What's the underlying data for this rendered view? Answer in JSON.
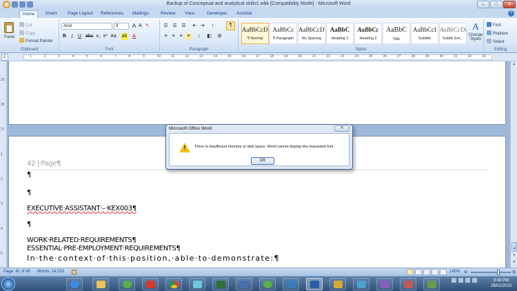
{
  "window": {
    "title": "Backup of Conceptual and analytical skills1.wbk [Compatibility Mode] - Microsoft Word",
    "minimize": "–",
    "maximize": "□",
    "close": "✕"
  },
  "tabs": [
    "Home",
    "Insert",
    "Page Layout",
    "References",
    "Mailings",
    "Review",
    "View",
    "Developer",
    "Acrobat"
  ],
  "ribbon": {
    "clipboard": {
      "label": "Clipboard",
      "paste": "Paste",
      "cut": "Cut",
      "copy": "Copy",
      "format_painter": "Format Painter"
    },
    "font": {
      "label": "Font",
      "name": "Arial",
      "size": "9"
    },
    "paragraph": {
      "label": "Paragraph"
    },
    "styles": {
      "label": "Styles",
      "items": [
        {
          "sample": "AaBbCcDc",
          "name": "¶ Normal"
        },
        {
          "sample": "AaBbCc",
          "name": "¶ Paragraph"
        },
        {
          "sample": "AaBbCcDc",
          "name": "No Spacing"
        },
        {
          "sample": "AaBbC",
          "name": "Heading 1"
        },
        {
          "sample": "AaBbCc",
          "name": "Heading 2"
        },
        {
          "sample": "AaBbC",
          "name": "Title"
        },
        {
          "sample": "AaBbCcI",
          "name": "Subtitle"
        },
        {
          "sample": "AaBbCcDt",
          "name": "Subtle Em..."
        }
      ],
      "change_styles": "Change Styles"
    },
    "editing": {
      "label": "Editing",
      "find": "Find",
      "replace": "Replace",
      "select": "Select"
    }
  },
  "ruler": {
    "marks": [
      "1",
      "2",
      "3",
      "4",
      "5",
      "6",
      "7",
      "8",
      "9",
      "10",
      "11",
      "12",
      "13",
      "14",
      "15",
      "16",
      "17",
      "18",
      "19",
      "20",
      "21",
      "22",
      "23",
      "24",
      "25",
      "26",
      "27",
      "28",
      "29",
      "30",
      "31",
      "32",
      "33"
    ]
  },
  "vruler": {
    "marks": [
      "25",
      "26",
      "27",
      "1",
      "2",
      "3",
      "4",
      "5"
    ]
  },
  "document": {
    "header": "42·|·Page¶",
    "lines": [
      "¶",
      "¶",
      "EXECUTIVE·ASSISTANT·–·KEX003¶",
      "¶",
      "WORK·RELATED·REQUIREMENTS¶",
      "ESSENTIAL·PRE-EMPLOYMENT·REQUIREMENTS¶",
      "In·the·context·of·this·position,·able·to·demonstrate:¶"
    ]
  },
  "dialog": {
    "title": "Microsoft Office Word",
    "close": "✕",
    "message": "There is insufficient memory or disk space. Word cannot display the requested font.",
    "ok": "OK"
  },
  "status": {
    "page": "Page: 41 of 45",
    "words": "Words: 14,033",
    "zoom": "145%"
  },
  "taskbar": {
    "time": "9:48 PM",
    "date": "29/01/2013"
  },
  "colors": {
    "ribbon": "#dbe8f7",
    "accent": "#15428b",
    "warning": "#f0c020"
  }
}
